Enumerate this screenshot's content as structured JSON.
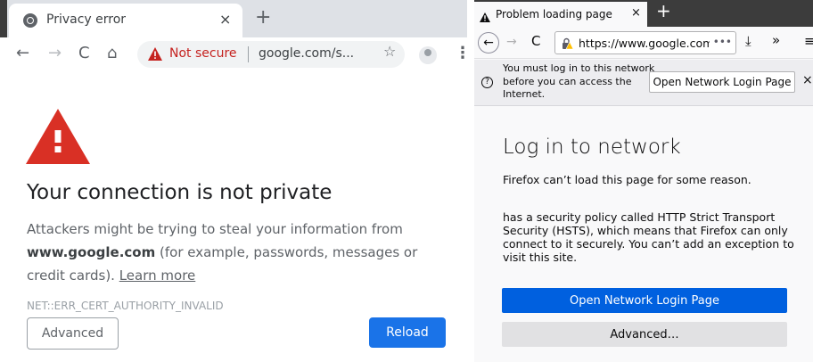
{
  "chrome": {
    "tab_title": "Privacy error",
    "tab_close": "×",
    "new_tab": "+",
    "omnibox": {
      "security_label": "Not secure",
      "url": "google.com/s..."
    },
    "heading": "Your connection is not private",
    "body": {
      "text_before": "Attackers might be trying to steal your information from ",
      "host": "www.google.com",
      "text_after": " (for example, passwords, messages or credit cards). ",
      "learn_more": "Learn more"
    },
    "error_code": "NET::ERR_CERT_AUTHORITY_INVALID",
    "advanced_label": "Advanced",
    "reload_label": "Reload",
    "colors": {
      "warning_red": "#d93025",
      "reload_blue": "#1a73e8",
      "not_secure_text": "#c5221f"
    }
  },
  "firefox": {
    "tab_title": "Problem loading page",
    "tab_close": "×",
    "new_tab": "+",
    "url": "https://www.google.com",
    "url_more": "•••",
    "notification": {
      "message": "You must log in to this network before you can access the Internet.",
      "button_label": "Open Network Login Page",
      "close": "×"
    },
    "heading": "Log in to network",
    "subheading": "Firefox can’t load this page for some reason.",
    "description": "has a security policy called HTTP Strict Transport Security (HSTS), which means that Firefox can only connect to it securely. You can’t add an exception to visit this site.",
    "login_button_label": "Open Network Login Page",
    "advanced_button_label": "Advanced…",
    "colors": {
      "login_button_blue": "#0060df",
      "advanced_button_gray": "#e1e1e3"
    }
  }
}
